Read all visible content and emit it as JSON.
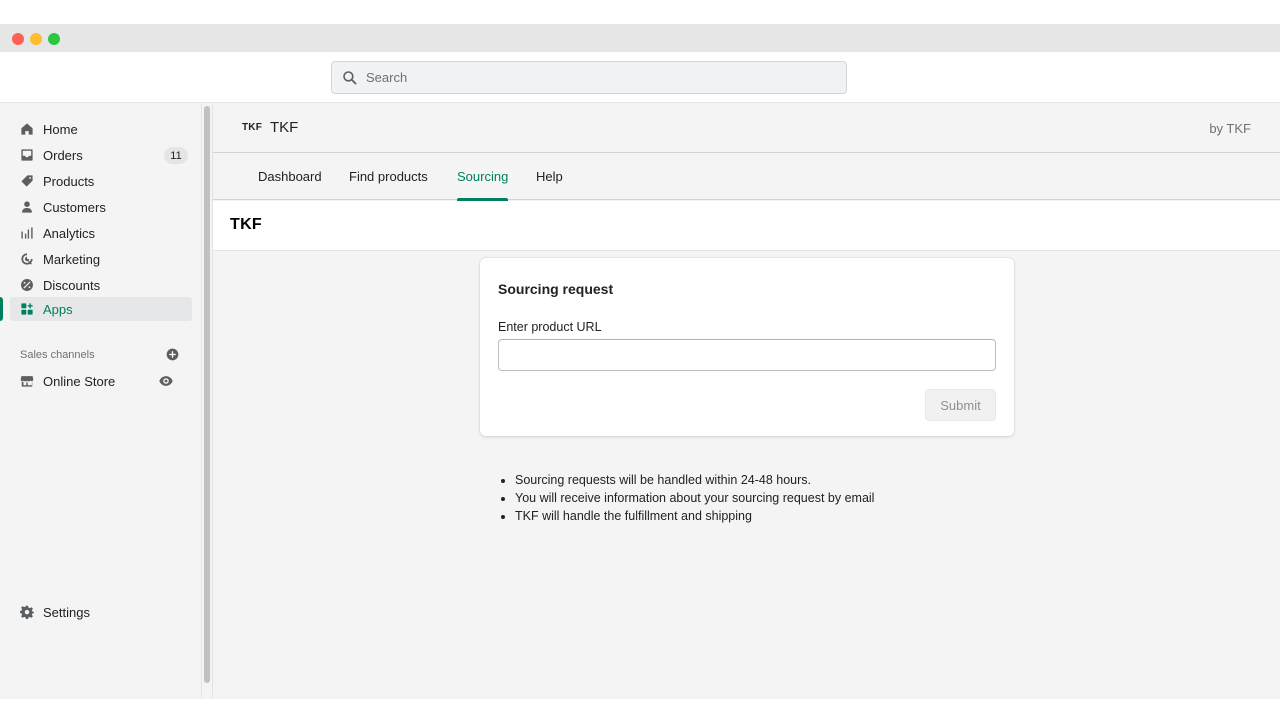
{
  "search": {
    "placeholder": "Search"
  },
  "sidebar": {
    "items": [
      {
        "label": "Home",
        "icon": "home-icon"
      },
      {
        "label": "Orders",
        "icon": "orders-icon",
        "badge": "11"
      },
      {
        "label": "Products",
        "icon": "tag-icon"
      },
      {
        "label": "Customers",
        "icon": "person-icon"
      },
      {
        "label": "Analytics",
        "icon": "bar-chart-icon"
      },
      {
        "label": "Marketing",
        "icon": "marketing-icon"
      },
      {
        "label": "Discounts",
        "icon": "discount-icon"
      },
      {
        "label": "Apps",
        "icon": "apps-icon",
        "active": true
      }
    ],
    "sales_channels_label": "Sales channels",
    "online_store_label": "Online Store",
    "settings_label": "Settings"
  },
  "app": {
    "logo_text": "TKF",
    "name": "TKF",
    "by_line": "by TKF",
    "brand_logo": "TKF"
  },
  "tabs": [
    {
      "label": "Dashboard"
    },
    {
      "label": "Find products"
    },
    {
      "label": "Sourcing",
      "active": true
    },
    {
      "label": "Help"
    }
  ],
  "card": {
    "title": "Sourcing request",
    "field_label": "Enter product URL",
    "url_value": "",
    "submit_label": "Submit"
  },
  "notes": [
    "Sourcing requests will be handled within 24-48 hours.",
    "You will receive information about your sourcing request by email",
    "TKF will handle the fulfillment and shipping"
  ],
  "colors": {
    "accent": "#008060",
    "sidebar_bg": "#f4f4f4",
    "window_red": "#fe5f57",
    "window_yellow": "#febc2e",
    "window_green": "#28c840"
  }
}
